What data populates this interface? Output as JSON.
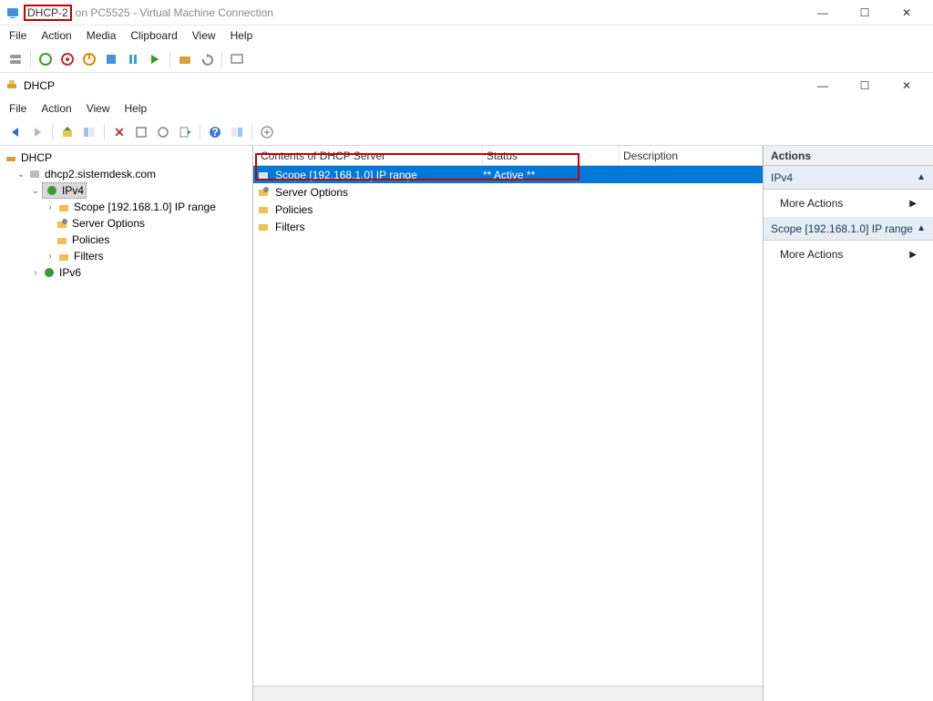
{
  "vm": {
    "title_main": "DHCP-2",
    "title_sub": "on PC5525 - Virtual Machine Connection",
    "menu": [
      "File",
      "Action",
      "Media",
      "Clipboard",
      "View",
      "Help"
    ]
  },
  "dhcp": {
    "app_title": "DHCP",
    "menu": [
      "File",
      "Action",
      "View",
      "Help"
    ]
  },
  "tree": {
    "root": "DHCP",
    "server": "dhcp2.sistemdesk.com",
    "ipv4": "IPv4",
    "scope": "Scope [192.168.1.0] IP range",
    "server_options": "Server Options",
    "policies": "Policies",
    "filters": "Filters",
    "ipv6": "IPv6"
  },
  "list": {
    "cols": [
      "Contents of DHCP Server",
      "Status",
      "Description"
    ],
    "rows": [
      {
        "name": "Scope [192.168.1.0] IP range",
        "status": "** Active **",
        "desc": "",
        "selected": true
      },
      {
        "name": "Server Options",
        "status": "",
        "desc": ""
      },
      {
        "name": "Policies",
        "status": "",
        "desc": ""
      },
      {
        "name": "Filters",
        "status": "",
        "desc": ""
      }
    ]
  },
  "actions": {
    "header": "Actions",
    "section1": "IPv4",
    "more": "More Actions",
    "section2": "Scope [192.168.1.0] IP range"
  }
}
